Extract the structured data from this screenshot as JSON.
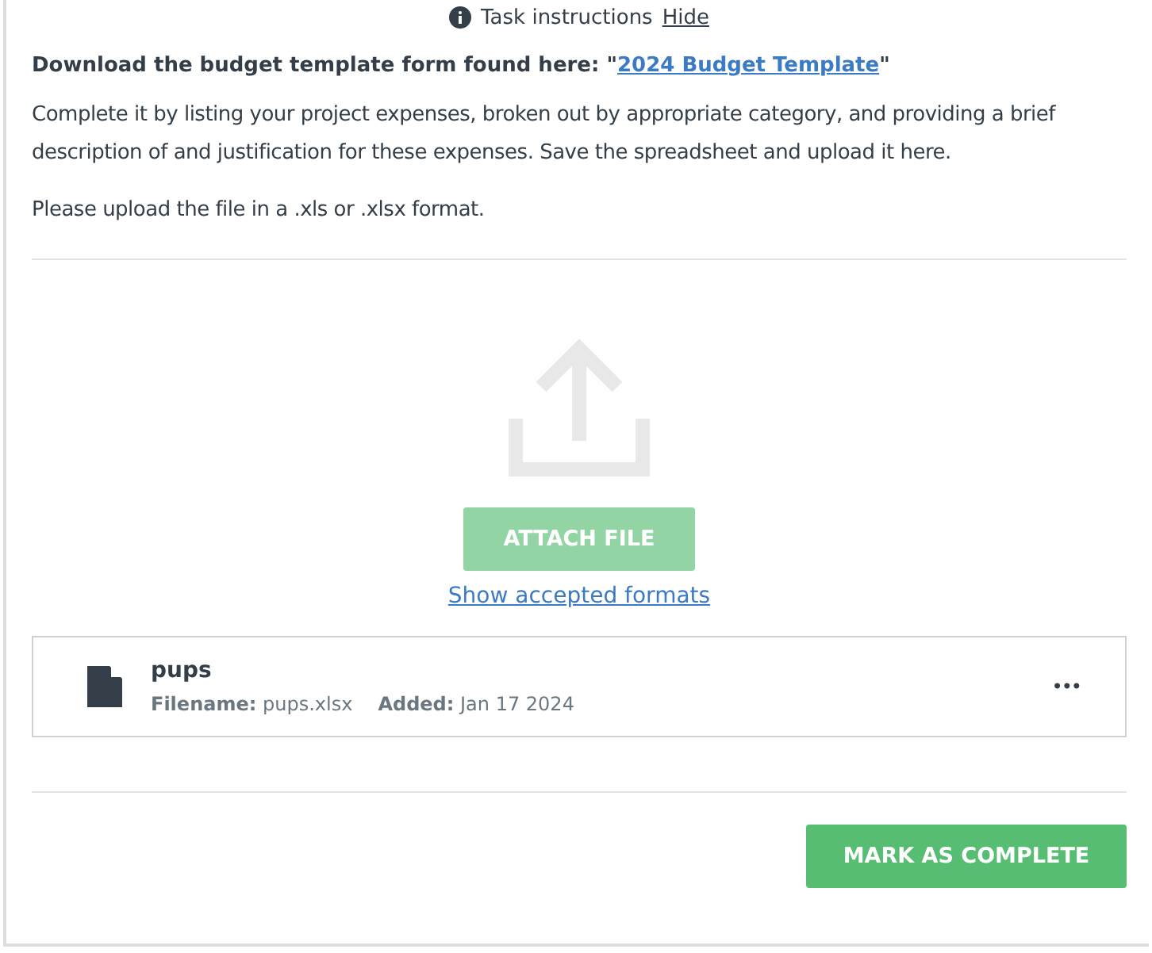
{
  "instructions_toggle": {
    "label": "Task instructions",
    "action": "Hide"
  },
  "download_line": {
    "text": "Download the budget template form found here: \"",
    "link": "2024 Budget Template",
    "after": "\""
  },
  "paragraphs": [
    "Complete it by listing your project expenses, broken out by appropriate category, and providing a brief description of and justification for these expenses. Save the spreadsheet and upload it here.",
    "Please upload the file in a .xls or .xlsx format."
  ],
  "upload": {
    "button": "ATTACH FILE",
    "disabled": true,
    "formats_link": "Show accepted formats"
  },
  "files": [
    {
      "name": "pups",
      "filename_label": "Filename:",
      "filename": "pups.xlsx",
      "added_label": "Added:",
      "added": "Jan 17 2024",
      "menu": "•••"
    }
  ],
  "complete_button": "MARK AS COMPLETE"
}
